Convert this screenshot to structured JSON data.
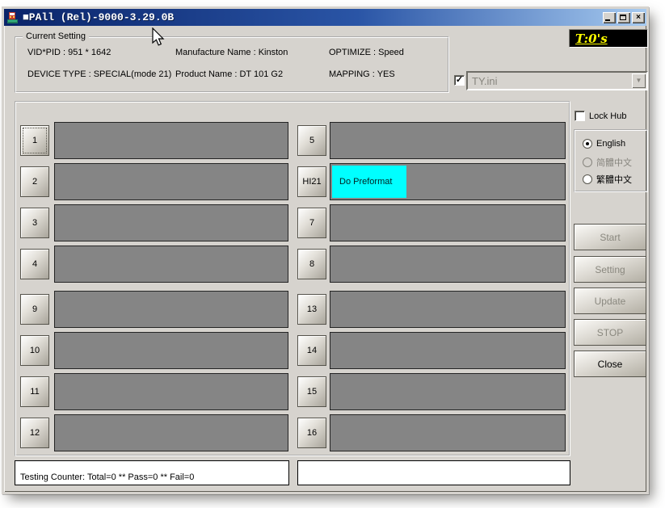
{
  "window": {
    "title": "■PAll (Rel)-9000-3.29.0B"
  },
  "icons": {
    "close": "×",
    "dropdown_arrow": "▼",
    "checkmark": "✓"
  },
  "timer": {
    "text": "T:0's",
    "fg": "#ffff00",
    "bg": "#000000"
  },
  "current_setting": {
    "label": "Current Setting",
    "rows": [
      [
        "VID*PID :  951 * 1642",
        "Manufacture Name : Kinston",
        "OPTIMIZE : Speed"
      ],
      [
        "DEVICE TYPE : SPECIAL(mode 21)",
        "Product Name : DT 101 G2",
        "MAPPING : YES"
      ]
    ]
  },
  "ini_selector": {
    "checked": true,
    "value": "TY.ini"
  },
  "hub": {
    "lock_label": "Lock Hub",
    "checked": false
  },
  "languages": {
    "options": [
      {
        "label": "English",
        "selected": true,
        "enabled": true
      },
      {
        "label": "简體中文",
        "selected": false,
        "enabled": false
      },
      {
        "label": "繁體中文",
        "selected": false,
        "enabled": true
      }
    ]
  },
  "actions": {
    "buttons": [
      {
        "label": "Start",
        "enabled": false
      },
      {
        "label": "Setting",
        "enabled": false
      },
      {
        "label": "Update",
        "enabled": false
      },
      {
        "label": "STOP",
        "enabled": false
      },
      {
        "label": "Close",
        "enabled": true
      }
    ]
  },
  "slots": [
    {
      "button_label": "1",
      "status": ""
    },
    {
      "button_label": "2",
      "status": ""
    },
    {
      "button_label": "3",
      "status": ""
    },
    {
      "button_label": "4",
      "status": ""
    },
    {
      "button_label": "5",
      "status": ""
    },
    {
      "button_label": "HI21",
      "status": "Do Preformat",
      "status_bg": "#00ffff"
    },
    {
      "button_label": "7",
      "status": ""
    },
    {
      "button_label": "8",
      "status": ""
    },
    {
      "button_label": "9",
      "status": ""
    },
    {
      "button_label": "10",
      "status": ""
    },
    {
      "button_label": "11",
      "status": ""
    },
    {
      "button_label": "12",
      "status": ""
    },
    {
      "button_label": "13",
      "status": ""
    },
    {
      "button_label": "14",
      "status": ""
    },
    {
      "button_label": "15",
      "status": ""
    },
    {
      "button_label": "16",
      "status": ""
    }
  ],
  "status_bar": {
    "testing_counter": "Testing Counter: Total=0 ** Pass=0 ** Fail=0",
    "message": ""
  },
  "colors": {
    "window_bg": "#d6d3ce",
    "titlebar_left": "#0a246a",
    "titlebar_right": "#a6caf0",
    "slot_panel": "#858585",
    "status_cyan": "#00ffff",
    "timer_text": "#ffff00"
  }
}
